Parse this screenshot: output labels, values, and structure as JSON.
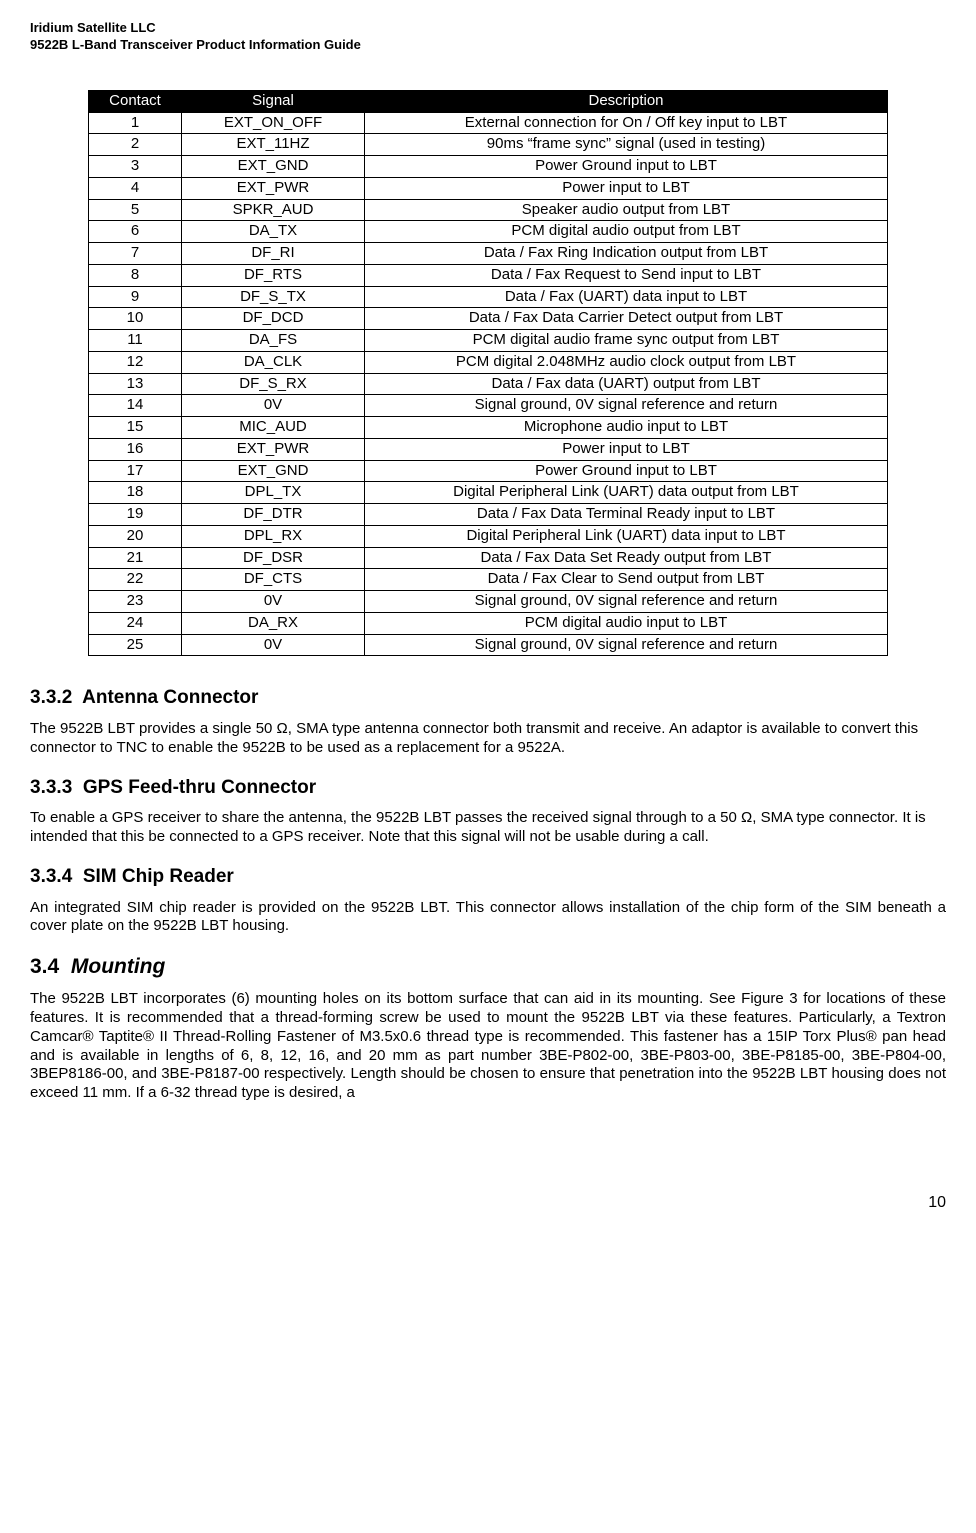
{
  "header": {
    "line1": "Iridium Satellite LLC",
    "line2": "9522B L-Band Transceiver Product Information Guide"
  },
  "table": {
    "headers": [
      "Contact",
      "Signal",
      "Description"
    ],
    "rows": [
      [
        "1",
        "EXT_ON_OFF",
        "External connection for On / Off key input to LBT"
      ],
      [
        "2",
        "EXT_11HZ",
        "90ms “frame sync” signal (used in testing)"
      ],
      [
        "3",
        "EXT_GND",
        "Power Ground input to LBT"
      ],
      [
        "4",
        "EXT_PWR",
        "Power input to LBT"
      ],
      [
        "5",
        "SPKR_AUD",
        "Speaker audio output from LBT"
      ],
      [
        "6",
        "DA_TX",
        "PCM digital audio output from LBT"
      ],
      [
        "7",
        "DF_RI",
        "Data / Fax Ring Indication output from LBT"
      ],
      [
        "8",
        "DF_RTS",
        "Data / Fax Request to Send input to LBT"
      ],
      [
        "9",
        "DF_S_TX",
        "Data / Fax (UART) data input to LBT"
      ],
      [
        "10",
        "DF_DCD",
        "Data / Fax Data Carrier Detect output from LBT"
      ],
      [
        "11",
        "DA_FS",
        "PCM digital audio frame sync output from LBT"
      ],
      [
        "12",
        "DA_CLK",
        "PCM digital 2.048MHz audio clock output from LBT"
      ],
      [
        "13",
        "DF_S_RX",
        "Data / Fax data (UART) output from LBT"
      ],
      [
        "14",
        "0V",
        "Signal ground, 0V signal reference and return"
      ],
      [
        "15",
        "MIC_AUD",
        "Microphone audio input to LBT"
      ],
      [
        "16",
        "EXT_PWR",
        "Power input to LBT"
      ],
      [
        "17",
        "EXT_GND",
        "Power Ground input to LBT"
      ],
      [
        "18",
        "DPL_TX",
        "Digital Peripheral Link (UART) data output from LBT"
      ],
      [
        "19",
        "DF_DTR",
        "Data / Fax Data Terminal Ready input to LBT"
      ],
      [
        "20",
        "DPL_RX",
        "Digital Peripheral Link (UART) data input to LBT"
      ],
      [
        "21",
        "DF_DSR",
        "Data / Fax Data Set Ready output from LBT"
      ],
      [
        "22",
        "DF_CTS",
        "Data / Fax Clear to Send output from LBT"
      ],
      [
        "23",
        "0V",
        "Signal ground, 0V signal reference and return"
      ],
      [
        "24",
        "DA_RX",
        "PCM digital audio input to LBT"
      ],
      [
        "25",
        "0V",
        "Signal ground, 0V signal reference and return"
      ]
    ]
  },
  "sections": {
    "s1": {
      "num": "3.3.2",
      "title": "Antenna Connector",
      "body": "The 9522B LBT provides a single 50 Ω, SMA type antenna connector both transmit and receive.  An adaptor is available to convert this connector to TNC to enable the 9522B to be used as a replacement for a 9522A."
    },
    "s2": {
      "num": "3.3.3",
      "title": "GPS Feed-thru Connector",
      "body": "To enable a GPS receiver to share the antenna, the 9522B LBT passes the received signal through to a 50 Ω, SMA type connector.  It is intended that this be connected to a GPS receiver.  Note that this signal will not be usable during a call."
    },
    "s3": {
      "num": "3.3.4",
      "title": "SIM Chip Reader",
      "body": "An integrated SIM chip reader is provided on the 9522B LBT. This connector allows installation of the chip form of the SIM beneath a cover plate on the 9522B LBT housing."
    },
    "s4": {
      "num": "3.4",
      "title": "Mounting",
      "body": "The 9522B LBT incorporates (6) mounting holes on its bottom surface that can aid in its mounting. See Figure 3 for locations of these features. It is recommended that a thread-forming screw be used to mount the 9522B LBT via these features. Particularly, a Textron Camcar® Taptite® II Thread-Rolling Fastener of M3.5x0.6 thread type is recommended. This fastener has a 15IP Torx Plus® pan head and is available in lengths of 6, 8, 12, 16, and 20 mm as part number 3BE-P802-00, 3BE-P803-00, 3BE-P8185-00, 3BE-P804-00, 3BEP8186-00, and 3BE-P8187-00 respectively. Length should be chosen to ensure that penetration into the 9522B LBT housing does not exceed 11 mm. If a 6-32 thread type is desired, a"
    }
  },
  "pageNumber": "10"
}
